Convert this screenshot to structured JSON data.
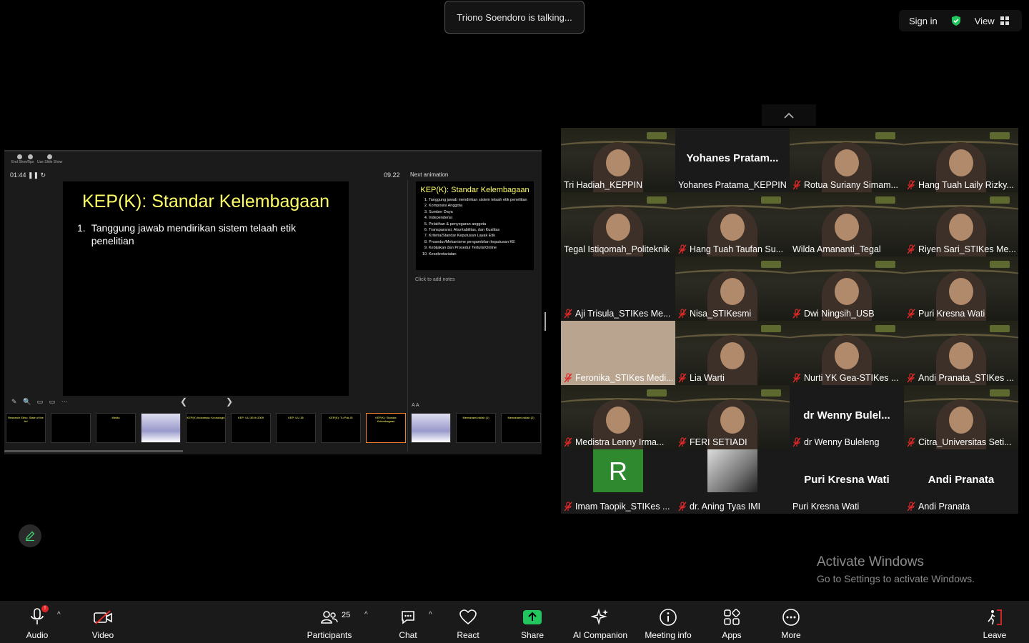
{
  "talking_indicator": "Triono Soendoro is talking...",
  "top_right": {
    "sign_in": "Sign in",
    "view": "View"
  },
  "presenter": {
    "controls": [
      "End Show",
      "Tips",
      "Use Slide Show"
    ],
    "timer": "01:44",
    "clock": "09.22",
    "next_label": "Next animation",
    "slide_title": "KEP(K): Standar Kelembagaan",
    "slide_item_number": "1.",
    "slide_item": "Tanggung jawab mendirikan sistem telaah etik penelitian",
    "next_title": "KEP(K): Standar Kelembagaan",
    "next_items": [
      "Tanggung jawab mendirikan sistem telaah etik penelitian",
      "Komposisi Anggota",
      "Sumber Daya",
      "Independensi",
      "Pelatihan & penyegaran anggota",
      "Transparansi, Akuntabilitas, dan Kualitas",
      "Kriteria/Standar Keputusan Layak Etik",
      "Prosedur/Mekanisme pengambilan keputusan KE",
      "Kebijakan dan Prosedur Tertulis/Online",
      "Kesekretariatan"
    ],
    "notes_placeholder": "Click to add notes",
    "thumbnails": [
      "Research Ethic: State of the Art",
      "",
      "Media",
      "",
      "KEP(K) Indonesia: Kronologis",
      "KEP: UU 36 th 2009",
      "KEP: UU 36",
      "KEP(K): Tu Pok-Si",
      "KEP(K): Standar Kelembagaan",
      "",
      "Memahami istilah (1)",
      "Memahami istilah (2)"
    ]
  },
  "participants": [
    {
      "name": "Tri Hadiah_KEPPIN",
      "muted": false,
      "type": "video"
    },
    {
      "name": "Yohanes Pratama_KEPPIN",
      "big": "Yohanes  Pratam...",
      "muted": false,
      "type": "name"
    },
    {
      "name": "Rotua Suriany Simam...",
      "muted": true,
      "type": "video"
    },
    {
      "name": "Hang Tuah Laily Rizky...",
      "muted": true,
      "type": "video"
    },
    {
      "name": "Tegal Istiqomah_Politeknik",
      "muted": false,
      "type": "video"
    },
    {
      "name": "Hang Tuah Taufan Su...",
      "muted": true,
      "type": "video"
    },
    {
      "name": "Wilda Amananti_Tegal",
      "muted": false,
      "type": "video"
    },
    {
      "name": "Riyen Sari_STIKes Me...",
      "muted": true,
      "type": "video"
    },
    {
      "name": "Aji Trisula_STIKes Me...",
      "muted": true,
      "type": "dark"
    },
    {
      "name": "Nisa_STIKesmi",
      "muted": true,
      "type": "video"
    },
    {
      "name": "Dwi Ningsih_USB",
      "muted": true,
      "type": "video"
    },
    {
      "name": "Puri Kresna Wati",
      "muted": true,
      "type": "video"
    },
    {
      "name": "Feronika_STIKes Medi...",
      "muted": true,
      "type": "wall"
    },
    {
      "name": "Lia Warti",
      "muted": true,
      "type": "video"
    },
    {
      "name": "Nurti YK Gea-STIKes ...",
      "muted": true,
      "type": "video"
    },
    {
      "name": "Andi Pranata_STIKes ...",
      "muted": true,
      "type": "video"
    },
    {
      "name": "Medistra Lenny Irma...",
      "muted": true,
      "type": "video"
    },
    {
      "name": "FERI SETIADI",
      "muted": true,
      "type": "video"
    },
    {
      "name": "dr Wenny Buleleng",
      "big": "dr  Wenny  Bulel...",
      "muted": true,
      "type": "name"
    },
    {
      "name": "Citra_Universitas Seti...",
      "muted": true,
      "type": "video"
    },
    {
      "name": "Imam Taopik_STIKes ...",
      "muted": true,
      "type": "avatarR",
      "initial": "R"
    },
    {
      "name": "dr. Aning Tyas IMI",
      "muted": true,
      "type": "avatarImg"
    },
    {
      "name": "Puri Kresna Wati",
      "big": "Puri Kresna Wati",
      "muted": false,
      "type": "name"
    },
    {
      "name": "Andi Pranata",
      "big": "Andi Pranata",
      "muted": true,
      "type": "name"
    }
  ],
  "watermark": {
    "line1": "Activate Windows",
    "line2": "Go to Settings to activate Windows."
  },
  "toolbar": {
    "audio": "Audio",
    "video": "Video",
    "participants": "Participants",
    "participants_count": "25",
    "chat": "Chat",
    "react": "React",
    "share": "Share",
    "ai": "AI Companion",
    "meeting_info": "Meeting info",
    "apps": "Apps",
    "more": "More",
    "leave": "Leave"
  },
  "colors": {
    "share_green": "#23c55e",
    "muted_red": "#e02828",
    "slide_title": "#ffff66"
  }
}
